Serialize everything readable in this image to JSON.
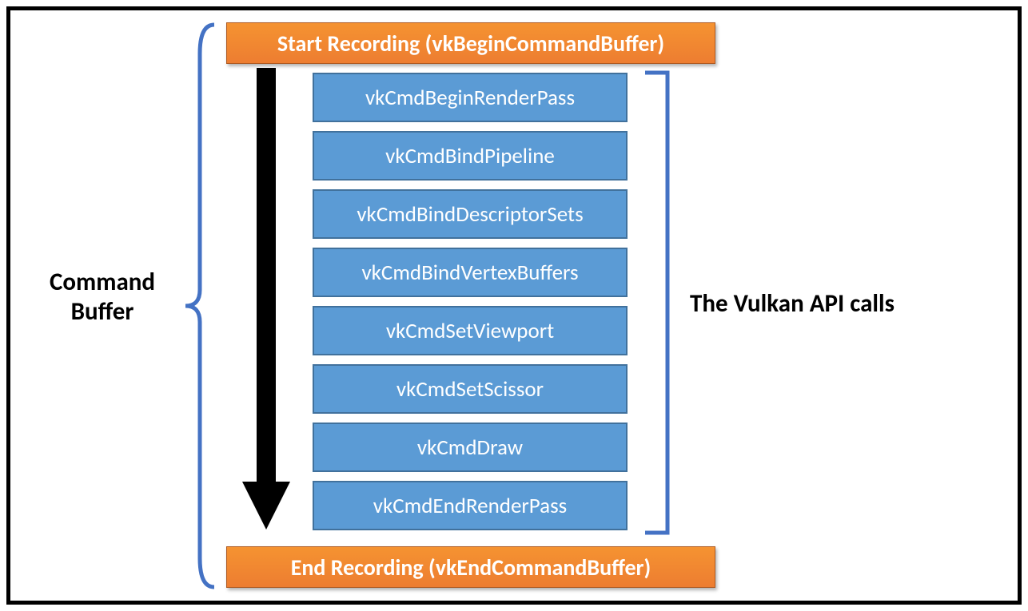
{
  "start_label": "Start Recording (vkBeginCommandBuffer)",
  "end_label": "End Recording (vkEndCommandBuffer)",
  "commands": [
    "vkCmdBeginRenderPass",
    "vkCmdBindPipeline",
    "vkCmdBindDescriptorSets",
    "vkCmdBindVertexBuffers",
    "vkCmdSetViewport",
    "vkCmdSetScissor",
    "vkCmdDraw",
    "vkCmdEndRenderPass"
  ],
  "left_label_line1": "Command",
  "left_label_line2": "Buffer",
  "right_label": "The Vulkan API calls",
  "colors": {
    "orange_top": "#f59331",
    "orange_bottom": "#ed7d31",
    "orange_border": "#ae5a21",
    "blue_fill": "#5b9bd5",
    "blue_border": "#41719c",
    "bracket_blue": "#4472c4"
  }
}
